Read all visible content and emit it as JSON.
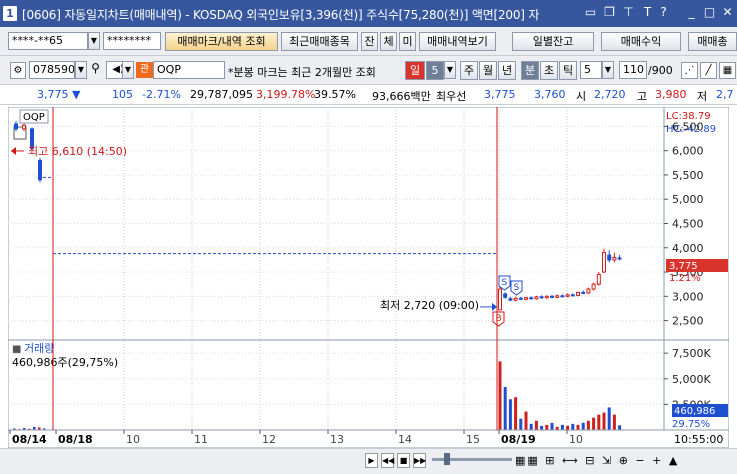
{
  "window": {
    "app_number": "1",
    "title": "[0606] 자동일지차트(매매내역) - KOSDAQ 외국인보유[3,396(천)] 주식수[75,280(천)] 액면[200] 자",
    "title_icons": [
      "window-icon",
      "copy-icon",
      "pin-icon",
      "text-icon",
      "help-icon",
      "minimize-icon",
      "maximize-icon",
      "close-icon"
    ]
  },
  "toolbar1": {
    "account": "****-**65",
    "password": "********",
    "btn_trade_mark": "매매마크/내역 조회",
    "btn_recent": "최근매매종목",
    "btn_jan": "잔",
    "btn_che": "체",
    "btn_mi": "미",
    "btn_history": "매매내역보기",
    "btn_daily_balance": "일별잔고",
    "btn_profit": "매매수익",
    "btn_trade_total": "매매총"
  },
  "toolbar2": {
    "code": "078590",
    "badge": "관",
    "name": "OQP",
    "notice": "*분봉 마크는 최근 2개월만 조회",
    "period_day": "일",
    "period_value": "5",
    "p_week": "주",
    "p_month": "월",
    "p_year": "년",
    "p_min": "분",
    "p_sec": "초",
    "p_tick": "틱",
    "interval_value": "5",
    "count": "110",
    "count_total": "/900"
  },
  "quote": {
    "price": "3,775",
    "change": "105",
    "change_pct": "-2.71%",
    "volume": "29,787,095",
    "vol_ratio": "3,199.78%",
    "turnover": "39.57%",
    "amount": "93,666백만",
    "bid_label": "최우선",
    "ask": "3,775",
    "bid": "3,760",
    "open_label": "시",
    "open": "2,720",
    "high_label": "고",
    "high": "3,980",
    "low_label": "저",
    "low": "2,7"
  },
  "chart_data": [
    {
      "type": "candlestick",
      "title": "OQP",
      "x_labels": [
        "08/14",
        "08/18",
        "10",
        "11",
        "12",
        "13",
        "14",
        "15",
        "08/19",
        "10"
      ],
      "y_ticks": [
        2500,
        3000,
        3500,
        4000,
        4500,
        5000,
        5500,
        6000,
        6500
      ],
      "y_tick_labels": [
        "2,500",
        "3,000",
        "3,500",
        "4,000",
        "4,500",
        "5,000",
        "5,500",
        "6,000",
        "6,500"
      ],
      "ylim": [
        2100,
        6900
      ],
      "lc": "LC:38.79",
      "hc": "HC:-42.89",
      "current_price": "3,775",
      "current_pct": "1.21%",
      "annotations": {
        "high": "최고 6,610 (14:50)",
        "low": "최저 2,720 (09:00)",
        "markers": [
          "S",
          "S",
          "B"
        ]
      },
      "candles_day1": [
        {
          "o": 6550,
          "c": 6450,
          "h": 6610,
          "l": 6400
        },
        {
          "o": 6450,
          "c": 6520,
          "h": 6560,
          "l": 6400
        },
        {
          "o": 6450,
          "c": 6050,
          "h": 6480,
          "l": 6000
        },
        {
          "o": 5800,
          "c": 5400,
          "h": 5850,
          "l": 5350
        }
      ],
      "dashed_level_1": 5450,
      "dashed_level_2": 3880,
      "candles_day3": [
        {
          "o": 2720,
          "c": 3150,
          "h": 3250,
          "l": 2720
        },
        {
          "o": 3050,
          "c": 2980,
          "h": 3080,
          "l": 2950
        },
        {
          "o": 2950,
          "c": 2920,
          "h": 2990,
          "l": 2900
        },
        {
          "o": 2920,
          "c": 2960,
          "h": 2990,
          "l": 2900
        },
        {
          "o": 2960,
          "c": 2940,
          "h": 2990,
          "l": 2920
        },
        {
          "o": 2940,
          "c": 2970,
          "h": 2990,
          "l": 2920
        },
        {
          "o": 2970,
          "c": 2950,
          "h": 3000,
          "l": 2930
        },
        {
          "o": 2950,
          "c": 2990,
          "h": 3010,
          "l": 2930
        },
        {
          "o": 2990,
          "c": 2970,
          "h": 3020,
          "l": 2950
        },
        {
          "o": 2970,
          "c": 3000,
          "h": 3020,
          "l": 2950
        },
        {
          "o": 3000,
          "c": 2980,
          "h": 3030,
          "l": 2960
        },
        {
          "o": 2980,
          "c": 3010,
          "h": 3040,
          "l": 2960
        },
        {
          "o": 3010,
          "c": 3000,
          "h": 3040,
          "l": 2980
        },
        {
          "o": 3000,
          "c": 3030,
          "h": 3060,
          "l": 2980
        },
        {
          "o": 3030,
          "c": 3020,
          "h": 3060,
          "l": 3000
        },
        {
          "o": 3020,
          "c": 3080,
          "h": 3100,
          "l": 3000
        },
        {
          "o": 3080,
          "c": 3070,
          "h": 3120,
          "l": 3050
        },
        {
          "o": 3070,
          "c": 3150,
          "h": 3180,
          "l": 3050
        },
        {
          "o": 3150,
          "c": 3250,
          "h": 3280,
          "l": 3120
        },
        {
          "o": 3250,
          "c": 3450,
          "h": 3500,
          "l": 3220
        },
        {
          "o": 3500,
          "c": 3900,
          "h": 3980,
          "l": 3480
        },
        {
          "o": 3850,
          "c": 3750,
          "h": 3950,
          "l": 3700
        },
        {
          "o": 3750,
          "c": 3800,
          "h": 3900,
          "l": 3700
        },
        {
          "o": 3790,
          "c": 3775,
          "h": 3850,
          "l": 3740
        }
      ]
    },
    {
      "type": "bar",
      "title": "거래량",
      "subtitle": "460,986주(29,75%)",
      "y_ticks": [
        2500,
        5000,
        7500
      ],
      "y_tick_labels": [
        "2,500K",
        "5,000K",
        "7,500K"
      ],
      "ylim": [
        0,
        8200
      ],
      "current": "460,986",
      "current_pct": "29.75%",
      "volumes_day1": [
        150,
        80,
        200,
        120,
        300,
        250,
        150
      ],
      "volumes_day3": [
        6700,
        4200,
        3000,
        3200,
        1100,
        1800,
        600,
        900,
        400,
        500,
        700,
        300,
        500,
        400,
        600,
        500,
        700,
        900,
        1200,
        1500,
        1700,
        2200,
        1500,
        461
      ]
    }
  ],
  "time": "10:55:00",
  "colors": {
    "up": "#d0201c",
    "down": "#1f4fd1",
    "title_bar": "#36579e",
    "grid": "#b8b8b8"
  }
}
